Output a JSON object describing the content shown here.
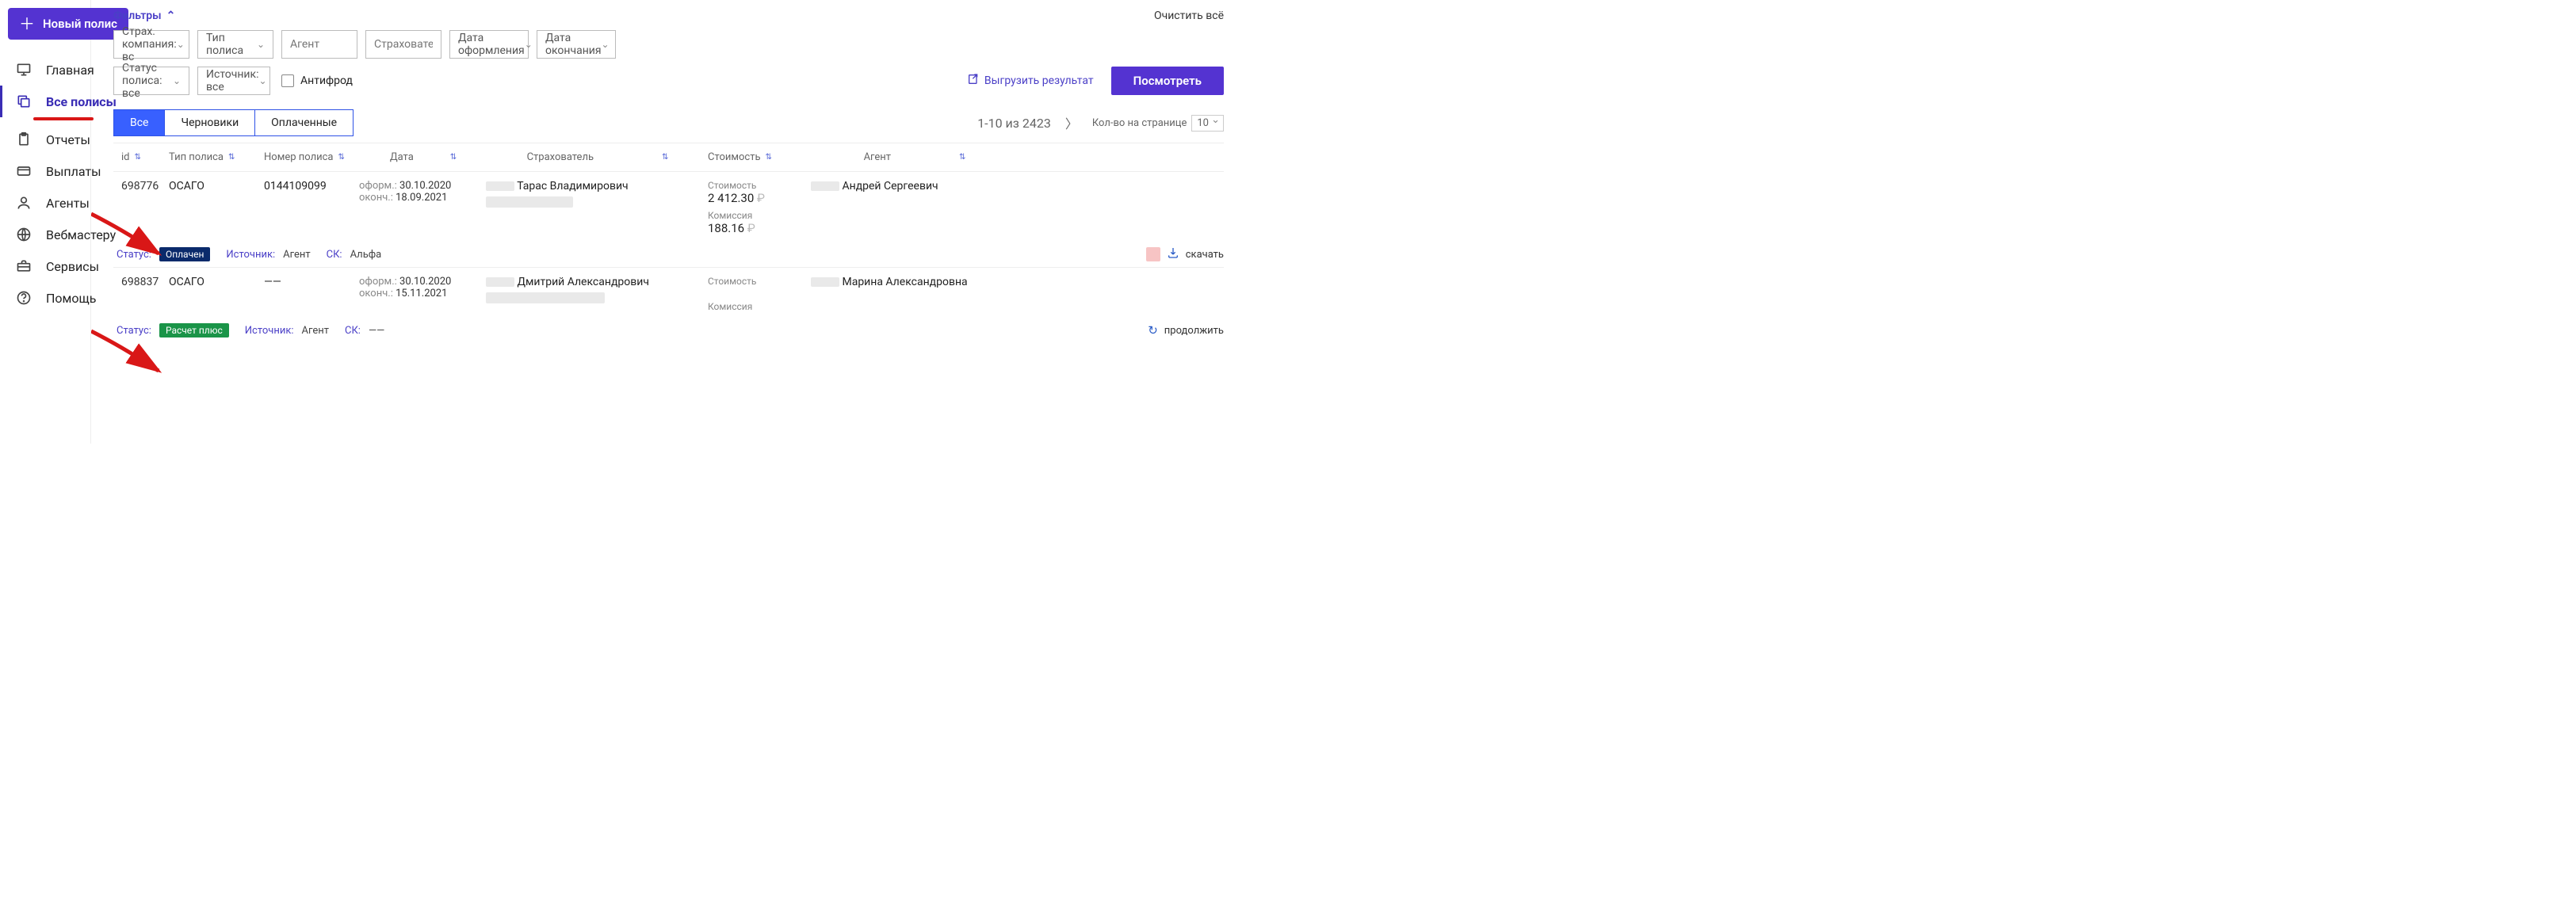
{
  "sidebar": {
    "new_btn": "Новый полис",
    "items": [
      {
        "key": "home",
        "label": "Главная"
      },
      {
        "key": "policies",
        "label": "Все полисы"
      },
      {
        "key": "reports",
        "label": "Отчеты"
      },
      {
        "key": "payouts",
        "label": "Выплаты"
      },
      {
        "key": "agents",
        "label": "Агенты"
      },
      {
        "key": "webmaster",
        "label": "Вебмастеру"
      },
      {
        "key": "services",
        "label": "Сервисы"
      },
      {
        "key": "help",
        "label": "Помощь"
      }
    ]
  },
  "filters": {
    "title": "Фильтры",
    "clear": "Очистить всё",
    "insurer": "Страх. компания: вс",
    "policy_type": "Тип полиса",
    "agent_ph": "Агент",
    "holder_ph": "Страхователь",
    "date_issued": "Дата оформления",
    "date_end": "Дата окончания",
    "status": "Статус полиса: все",
    "source": "Источник: все",
    "antifraud": "Антифрод",
    "export": "Выгрузить результат",
    "view_btn": "Посмотреть"
  },
  "tabs": {
    "all": "Все",
    "drafts": "Черновики",
    "paid": "Оплаченные"
  },
  "pager": {
    "range": "1-10 из 2423",
    "per_page_label": "Кол-во на странице",
    "per_page_value": "10"
  },
  "columns": {
    "id": "id",
    "type": "Тип полиса",
    "num": "Номер полиса",
    "date": "Дата",
    "holder": "Страхователь",
    "cost": "Стоимость",
    "agent": "Агент"
  },
  "labels": {
    "issued": "оформ.:",
    "end": "оконч.:",
    "cost": "Стоимость",
    "commission": "Комиссия",
    "status": "Статус:",
    "source": "Источник:",
    "insurer_short": "СК:",
    "download": "скачать",
    "continue": "продолжить"
  },
  "rows": [
    {
      "id": "698776",
      "type": "ОСАГО",
      "num": "0144109099",
      "date_issued": "30.10.2020",
      "date_end": "18.09.2021",
      "holder": "Тарас Владимирович",
      "cost": "2 412.30",
      "commission": "188.16",
      "agent": "Андрей Сергеевич",
      "status_text": "Оплачен",
      "status_class": "st-paid",
      "source": "Агент",
      "insurer": "Альфа",
      "action": "download"
    },
    {
      "id": "698837",
      "type": "ОСАГО",
      "num": "——",
      "date_issued": "30.10.2020",
      "date_end": "15.11.2021",
      "holder": "Дмитрий Александрович",
      "cost": "",
      "commission": "",
      "agent": "Марина Александровна",
      "status_text": "Расчет плюс",
      "status_class": "st-calc",
      "source": "Агент",
      "insurer": "——",
      "action": "continue"
    }
  ]
}
